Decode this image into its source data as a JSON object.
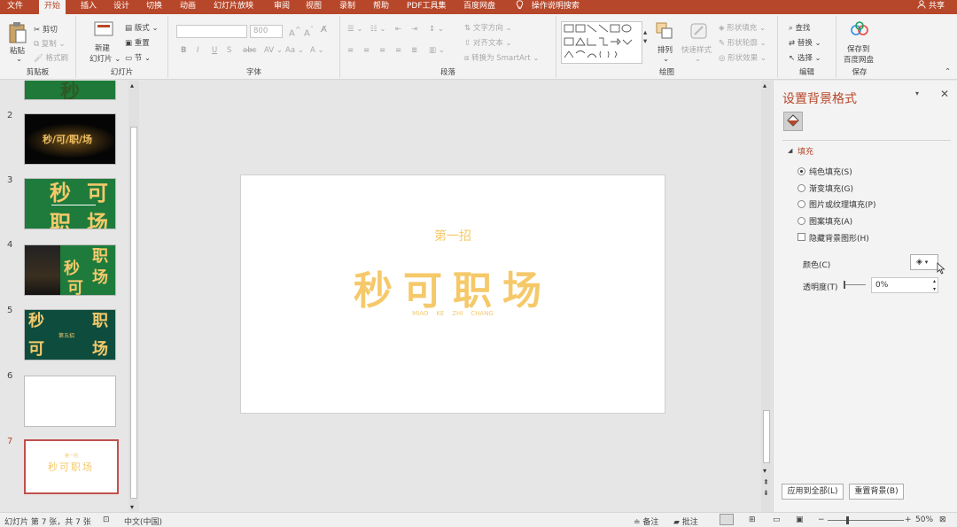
{
  "tabs": [
    "文件",
    "开始",
    "插入",
    "设计",
    "切换",
    "动画",
    "幻灯片放映",
    "审阅",
    "视图",
    "录制",
    "帮助",
    "PDF工具集",
    "百度网盘",
    "操作说明搜索"
  ],
  "active_tab_index": 1,
  "share_label": "共享",
  "ribbon": {
    "clipboard": {
      "label": "剪贴板",
      "paste": "粘贴",
      "cut": "剪切",
      "copy": "复制",
      "format_painter": "格式刷"
    },
    "slides": {
      "label": "幻灯片",
      "new_slide": "新建",
      "new_slide2": "幻灯片",
      "layout": "版式",
      "reset": "重置",
      "section": "节"
    },
    "font": {
      "label": "字体",
      "size_value": "800"
    },
    "paragraph": {
      "label": "段落",
      "text_direction": "文字方向",
      "align_text": "对齐文本",
      "smartart": "转换为 SmartArt"
    },
    "drawing": {
      "label": "绘图",
      "arrange": "排列",
      "quick_styles": "快速样式",
      "shape_fill": "形状填充",
      "shape_outline": "形状轮廓",
      "shape_effects": "形状效果"
    },
    "editing": {
      "label": "编辑",
      "find": "查找",
      "replace": "替换",
      "select": "选择"
    },
    "save": {
      "label": "保存",
      "save_to": "保存到",
      "baidu": "百度网盘"
    }
  },
  "thumbnails": [
    {
      "num": "2",
      "text": "秒/可/职/场"
    },
    {
      "num": "3",
      "text1": "秒",
      "text2": "可",
      "text3": "职",
      "text4": "场"
    },
    {
      "num": "4",
      "text1": "职",
      "text2": "秒",
      "text3": "场",
      "text4": "可"
    },
    {
      "num": "5",
      "text1": "秒",
      "text2": "职",
      "text3": "可",
      "text4": "场",
      "badge": "第五招"
    },
    {
      "num": "6"
    },
    {
      "num": "7",
      "small": "第一招",
      "text": "秒可职场"
    }
  ],
  "thumb1_text": "秒",
  "slide": {
    "subtitle": "第一招",
    "title": "秒可职场",
    "pinyin": "MIAO    KE    ZHI    CHANG",
    "accent_color": "#f5c96a"
  },
  "format_pane": {
    "title": "设置背景格式",
    "section": "填充",
    "options": [
      "纯色填充(S)",
      "渐变填充(G)",
      "图片或纹理填充(P)",
      "图案填充(A)"
    ],
    "selected_option": 0,
    "hide_bg": "隐藏背景图形(H)",
    "color_label": "颜色(C)",
    "transparency_label": "透明度(T)",
    "transparency_value": "0%",
    "apply_all": "应用到全部(L)",
    "reset_bg": "重置背景(B)"
  },
  "status": {
    "slide_info": "幻灯片 第 7 张，共 7 张",
    "language": "中文(中国)",
    "notes": "备注",
    "comments": "批注",
    "zoom": "50%"
  },
  "colors": {
    "brand": "#b7472a",
    "accent": "#f5c96a",
    "green": "#2e7d32",
    "dark": "#0d0d0d"
  }
}
